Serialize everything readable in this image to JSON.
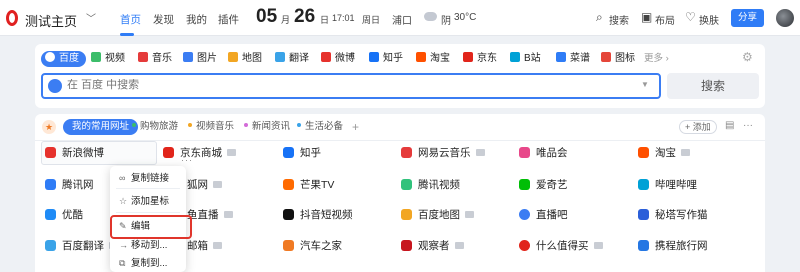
{
  "header": {
    "title": "测试主页",
    "nav": [
      "首页",
      "发现",
      "我的",
      "插件"
    ],
    "date": {
      "month": "05",
      "month_unit": "月",
      "day": "26",
      "day_unit": "日",
      "time": "17:01",
      "weekday": "周日"
    },
    "weather": {
      "city": "浦口",
      "condition": "阴",
      "temp": "30°C"
    },
    "tools": {
      "search": "搜索",
      "layout": "布局",
      "skin": "换肤"
    },
    "share": "分享"
  },
  "search": {
    "engines": [
      "百度",
      "视频",
      "音乐",
      "图片",
      "地图",
      "翻译",
      "微博",
      "知乎",
      "淘宝",
      "京东",
      "B站",
      "菜谱",
      "图标"
    ],
    "more": "更多",
    "placeholder": "在 百度 中搜索",
    "button": "搜索"
  },
  "bookmarks": {
    "tabs": [
      "我的常用网址",
      "购物旅游",
      "视频音乐",
      "新闻资讯",
      "生活必备"
    ],
    "add_site": "+ 添加",
    "sites": [
      {
        "label": "新浪微博",
        "folder": false
      },
      {
        "label": "京东商城",
        "folder": true
      },
      {
        "label": "知乎",
        "folder": false
      },
      {
        "label": "网易云音乐",
        "folder": true
      },
      {
        "label": "唯品会",
        "folder": false
      },
      {
        "label": "淘宝",
        "folder": true
      },
      {
        "label": "腾讯网",
        "folder": false
      },
      {
        "label": "狐网",
        "folder": true
      },
      {
        "label": "芒果TV",
        "folder": false
      },
      {
        "label": "腾讯视频",
        "folder": false
      },
      {
        "label": "爱奇艺",
        "folder": false
      },
      {
        "label": "哔哩哔哩",
        "folder": false
      },
      {
        "label": "优酷",
        "folder": false
      },
      {
        "label": "鱼直播",
        "folder": true
      },
      {
        "label": "抖音短视频",
        "folder": false
      },
      {
        "label": "百度地图",
        "folder": true
      },
      {
        "label": "直播吧",
        "folder": false
      },
      {
        "label": "秘塔写作猫",
        "folder": false
      },
      {
        "label": "百度翻译",
        "folder": true
      },
      {
        "label": "邮箱",
        "folder": true
      },
      {
        "label": "汽车之家",
        "folder": false
      },
      {
        "label": "观察者",
        "folder": true
      },
      {
        "label": "什么值得买",
        "folder": true
      },
      {
        "label": "携程旅行网",
        "folder": false
      }
    ]
  },
  "context_menu": {
    "items": [
      "复制链接",
      "添加星标",
      "编辑",
      "移动到...",
      "复制到..."
    ]
  },
  "colors": {
    "accent": "#3b7df3",
    "brand": "#e02020",
    "highlight": "#e0352b"
  }
}
